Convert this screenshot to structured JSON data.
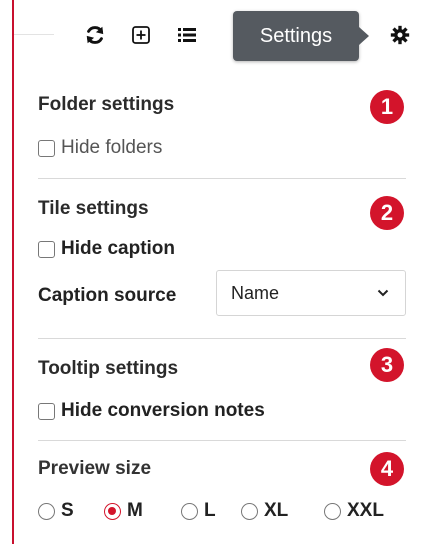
{
  "toolbar": {
    "tooltip": "Settings",
    "icons": [
      "refresh-icon",
      "add-icon",
      "list-icon",
      "gear-icon"
    ]
  },
  "sections": {
    "folder": {
      "title": "Folder settings",
      "badge": "1",
      "hide_label": "Hide folders"
    },
    "tile": {
      "title": "Tile settings",
      "badge": "2",
      "hide_label": "Hide caption",
      "caption_source_label": "Caption source",
      "caption_source_value": "Name"
    },
    "tooltip": {
      "title": "Tooltip settings",
      "badge": "3",
      "hide_label": "Hide conversion notes"
    },
    "preview": {
      "title": "Preview size",
      "badge": "4",
      "options": [
        "S",
        "M",
        "L",
        "XL",
        "XXL"
      ],
      "selected": "M"
    }
  },
  "colors": {
    "accent": "#d3142b",
    "tooltip_bg": "#555a60"
  }
}
